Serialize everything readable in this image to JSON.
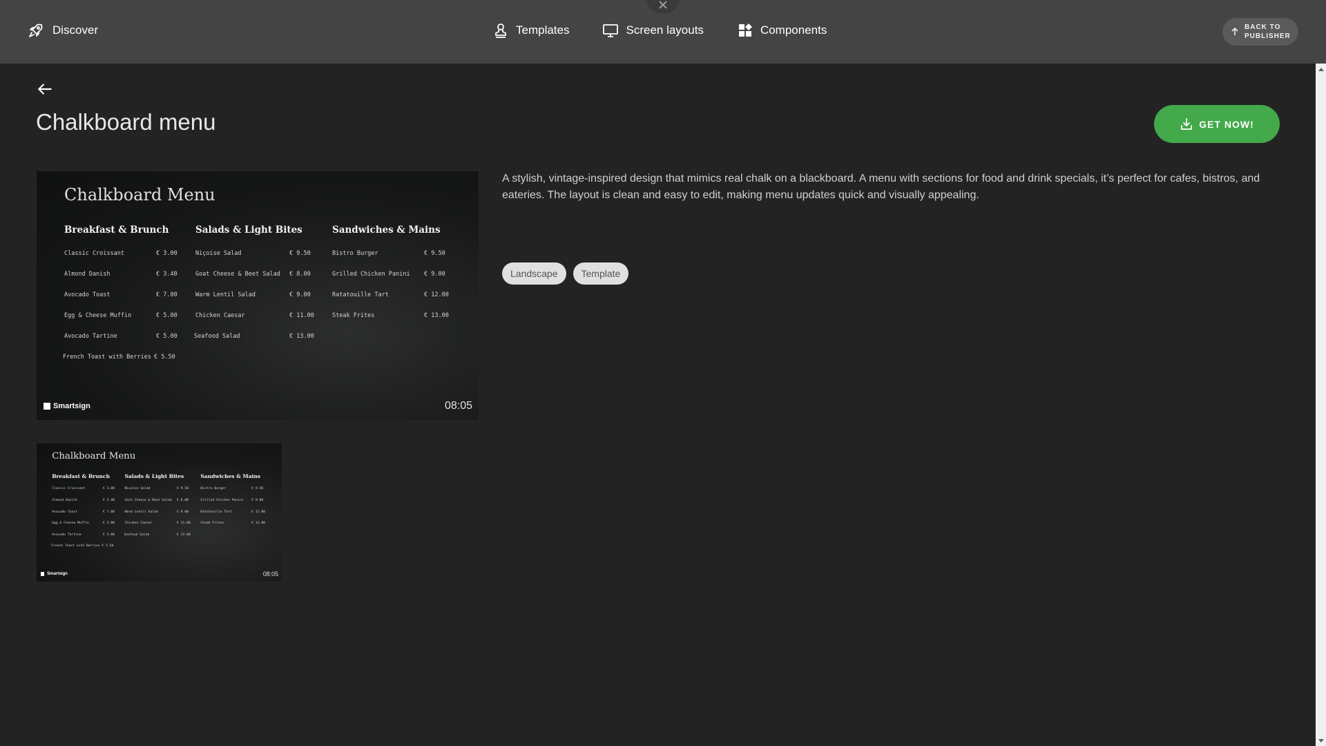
{
  "nav": {
    "discover": "Discover",
    "templates": "Templates",
    "screen_layouts": "Screen layouts",
    "components": "Components",
    "back_to_publisher": "Back to publisher"
  },
  "page": {
    "title": "Chalkboard menu",
    "get_now": "GET NOW!",
    "description": "A stylish, vintage-inspired design that mimics real chalk on a blackboard. A menu with sections for food and drink specials, it’s perfect for cafes, bistros, and eateries. The layout is clean and easy to edit, making menu updates quick and visually appealing.",
    "tags": [
      "Landscape",
      "Template"
    ]
  },
  "preview": {
    "title": "Chalkboard Menu",
    "logo": "Smartsign",
    "time": "08:05",
    "columns": [
      {
        "heading": "Breakfast & Brunch",
        "items": [
          {
            "name": "Classic Croissant",
            "price": "€ 3.00"
          },
          {
            "name": "Almond Danish",
            "price": "€ 3.40"
          },
          {
            "name": "Avocado Toast",
            "price": "€ 7.00"
          },
          {
            "name": "Egg & Cheese Muffin",
            "price": "€ 5.00"
          },
          {
            "name": "Avocado Tartine",
            "price": "€ 5.00"
          },
          {
            "name": "French Toast with Berries",
            "price": "€ 5.50"
          }
        ]
      },
      {
        "heading": "Salads & Light Bites",
        "items": [
          {
            "name": "Niçoise Salad",
            "price": "€ 9.50"
          },
          {
            "name": "Goat Cheese & Beet Salad",
            "price": "€ 8.00"
          },
          {
            "name": "Warm Lentil Salad",
            "price": "€ 9.00"
          },
          {
            "name": "Chicken Caesar",
            "price": "€ 11.00"
          },
          {
            "name": "Seafood Salad",
            "price": "€ 13.00"
          }
        ]
      },
      {
        "heading": "Sandwiches & Mains",
        "items": [
          {
            "name": "Bistro Burger",
            "price": "€ 9.50"
          },
          {
            "name": "Grilled Chicken Panini",
            "price": "€ 9.00"
          },
          {
            "name": "Ratatouille Tart",
            "price": "€ 12.00"
          },
          {
            "name": "Steak Frites",
            "price": "€ 13.00"
          }
        ]
      }
    ]
  },
  "icons": {
    "discover": "rocket-icon",
    "templates": "person-stamp-icon",
    "screen_layouts": "monitor-icon",
    "components": "widgets-icon",
    "back": "arrow-left-icon",
    "get_now": "download-icon",
    "back_to_publisher": "arrow-up-icon",
    "close": "close-icon"
  },
  "colors": {
    "accent": "#43a94a",
    "topbar": "#444444",
    "background": "#232323"
  }
}
